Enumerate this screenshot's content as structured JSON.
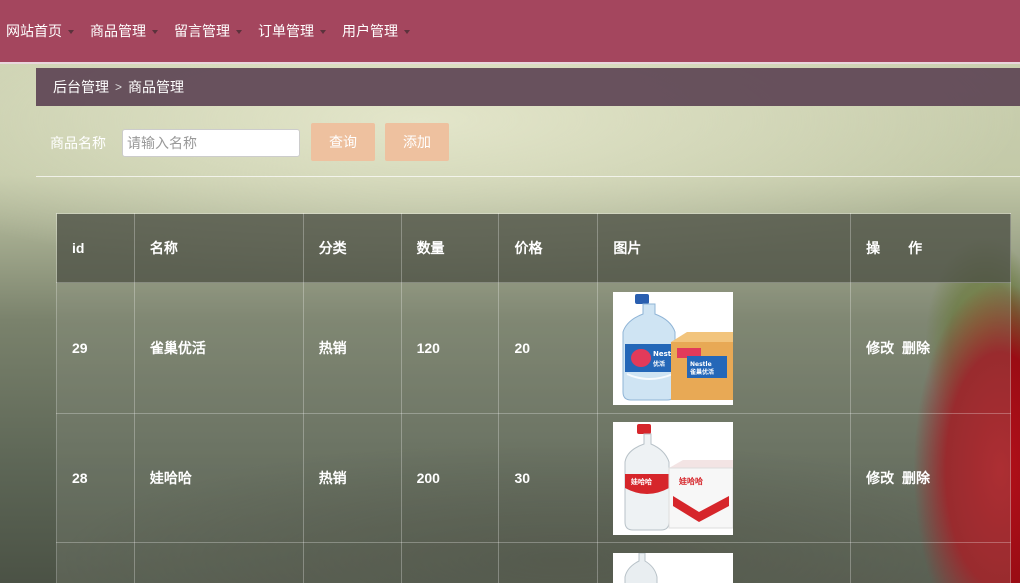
{
  "nav": {
    "items": [
      {
        "label": "网站首页"
      },
      {
        "label": "商品管理"
      },
      {
        "label": "留言管理"
      },
      {
        "label": "订单管理"
      },
      {
        "label": "用户管理"
      }
    ]
  },
  "breadcrumb": {
    "root": "后台管理",
    "separator": ">",
    "current": "商品管理"
  },
  "search": {
    "label": "商品名称",
    "placeholder": "请输入名称",
    "value": "",
    "query_label": "查询",
    "add_label": "添加"
  },
  "table": {
    "headers": {
      "id": "id",
      "name": "名称",
      "category": "分类",
      "quantity": "数量",
      "price": "价格",
      "image": "图片",
      "ops": "操　　作"
    },
    "rows": [
      {
        "id": "29",
        "name": "雀巢优活",
        "category": "热销",
        "quantity": "120",
        "price": "20",
        "image": "water-bottle-with-box-image",
        "edit": "修改",
        "delete": "删除"
      },
      {
        "id": "28",
        "name": "娃哈哈",
        "category": "热销",
        "quantity": "200",
        "price": "30",
        "image": "water-bottle-with-box-image",
        "edit": "修改",
        "delete": "删除"
      },
      {
        "id": "",
        "name": "",
        "category": "",
        "quantity": "",
        "price": "",
        "image": "water-bottle-image",
        "edit": "",
        "delete": ""
      }
    ]
  },
  "colors": {
    "nav_bg": "#a4465e",
    "breadcrumb_bg": "#5f4655",
    "button_bg": "#eec19f",
    "nestle_blue": "#1f5fb0",
    "wahaha_red": "#d6262b"
  }
}
